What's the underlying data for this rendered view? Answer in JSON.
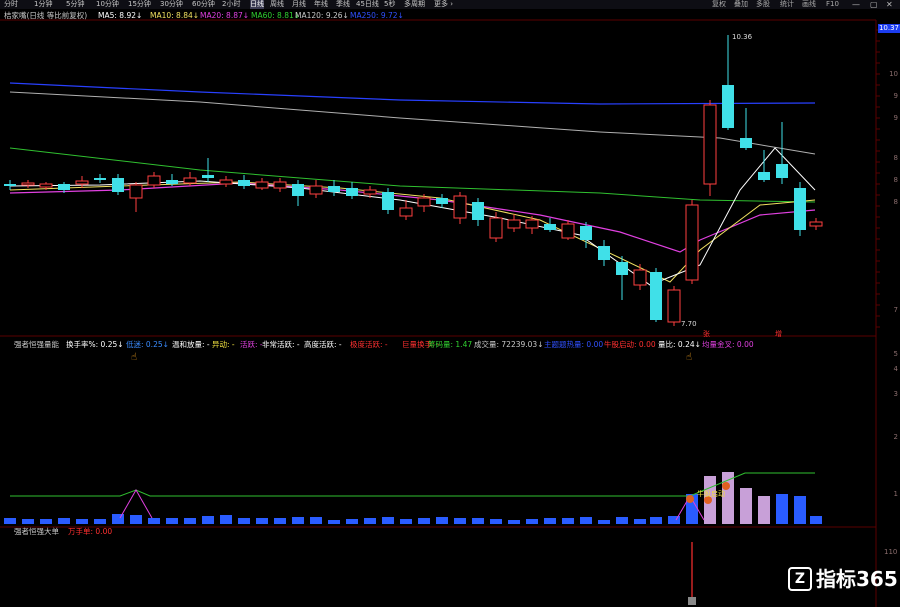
{
  "toolbar": {
    "tabs": [
      "分时",
      "1分钟",
      "5分钟",
      "10分钟",
      "15分钟",
      "30分钟",
      "60分钟",
      "2小时",
      "日线",
      "周线",
      "月线",
      "年线",
      "季线",
      "45日线",
      "5秒",
      "多周期",
      "更多 ›"
    ],
    "active": "日线",
    "right_buttons": [
      "复权",
      "叠加",
      "多股",
      "统计",
      "画线",
      "F10"
    ]
  },
  "main_panel": {
    "stock_title": "桔家嘴(日线 等比前复权)",
    "ma_labels": [
      {
        "text": "MA5: 8.92↓",
        "color": "#ffffff"
      },
      {
        "text": "MA10: 8.84↓",
        "color": "#f0e060"
      },
      {
        "text": "MA20: 8.87↓",
        "color": "#e040e0"
      },
      {
        "text": "MA60: 8.81↓",
        "color": "#30d030"
      },
      {
        "text": "MA120: 9.26↓",
        "color": "#c8c8c8"
      },
      {
        "text": "MA250: 9.72↓",
        "color": "#3050ff"
      }
    ],
    "price_axis": [
      "10",
      "9",
      "9",
      "8",
      "8",
      "8",
      "7"
    ],
    "current_price": "10.37",
    "high_label": "10.36",
    "low_label": "7.70",
    "zhang_label": "张",
    "zeng_label": "增"
  },
  "indicator_panel": {
    "title": "强者恒强量能",
    "labels": [
      {
        "text": "换手率%: 0.25↓",
        "color": "#ffffff"
      },
      {
        "text": "低迷: 0.25↓",
        "color": "#3a8cff"
      },
      {
        "text": "温和放量: -",
        "color": "#ffffff"
      },
      {
        "text": "异动: -",
        "color": "#f0e040"
      },
      {
        "text": "活跃: -",
        "color": "#e040e0"
      },
      {
        "text": "非常活跃: -",
        "color": "#ffffff"
      },
      {
        "text": "高度活跃: -",
        "color": "#ffffff"
      },
      {
        "text": "极度活跃: -",
        "color": "#ff3030"
      },
      {
        "text": "巨量换手: -",
        "color": "#ff3030"
      },
      {
        "text": "筹码量: 1.47",
        "color": "#30d030"
      },
      {
        "text": "成交量: 72239.03↓",
        "color": "#c8c8c8"
      },
      {
        "text": "主题题热量: 0.00",
        "color": "#3050ff"
      },
      {
        "text": "牛股启动: 0.00",
        "color": "#ff3030"
      },
      {
        "text": "量比: 0.24↓",
        "color": "#ffffff"
      },
      {
        "text": "均量金叉: 0.00",
        "color": "#e040e0"
      }
    ],
    "axis": [
      "5",
      "4",
      "3",
      "2",
      "1"
    ],
    "annotation": "牛股启动"
  },
  "bottom_panel": {
    "title": "强者恒强大单",
    "label": "万手单: 0.00",
    "axis_value": "110"
  },
  "logo_text": "指标365"
}
